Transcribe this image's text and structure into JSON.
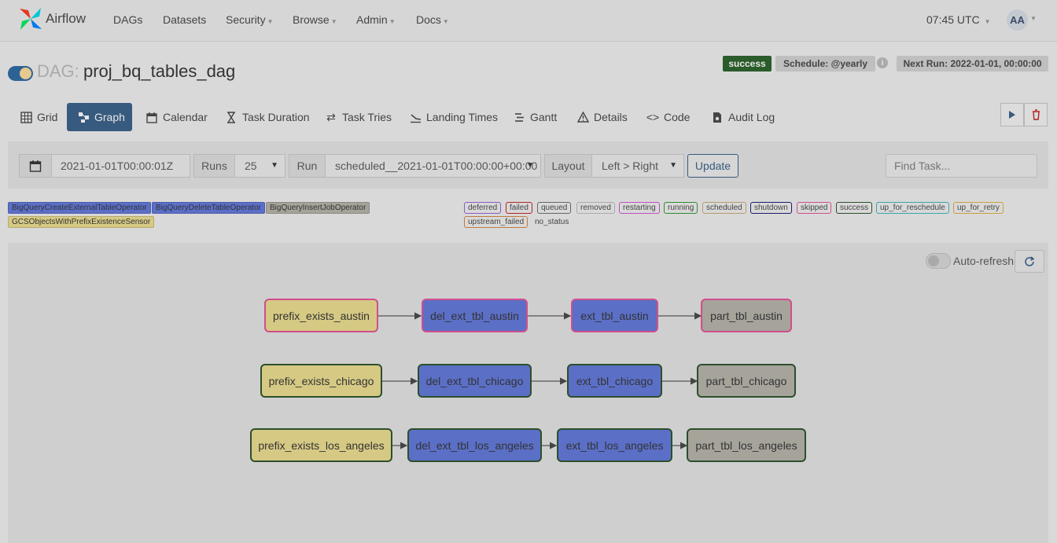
{
  "navbar": {
    "brand": "Airflow",
    "items": [
      {
        "label": "DAGs",
        "dropdown": false
      },
      {
        "label": "Datasets",
        "dropdown": false
      },
      {
        "label": "Security",
        "dropdown": true
      },
      {
        "label": "Browse",
        "dropdown": true
      },
      {
        "label": "Admin",
        "dropdown": true
      },
      {
        "label": "Docs",
        "dropdown": true
      }
    ],
    "clock": "07:45 UTC",
    "avatar": "AA"
  },
  "dag": {
    "prefix": "DAG:",
    "name": "proj_bq_tables_dag",
    "status": "success",
    "schedule": "Schedule: @yearly",
    "next_run": "Next Run: 2022-01-01, 00:00:00",
    "toggle_on": true
  },
  "tabs": [
    {
      "label": "Grid",
      "icon": "grid-icon"
    },
    {
      "label": "Graph",
      "icon": "graph-icon",
      "active": true
    },
    {
      "label": "Calendar",
      "icon": "calendar-icon"
    },
    {
      "label": "Task Duration",
      "icon": "hourglass-icon"
    },
    {
      "label": "Task Tries",
      "icon": "retry-icon"
    },
    {
      "label": "Landing Times",
      "icon": "landing-icon"
    },
    {
      "label": "Gantt",
      "icon": "gantt-icon"
    },
    {
      "label": "Details",
      "icon": "warning-icon"
    },
    {
      "label": "Code",
      "icon": "code-icon"
    },
    {
      "label": "Audit Log",
      "icon": "audit-icon"
    }
  ],
  "form": {
    "base_date": "2021-01-01T00:00:01Z",
    "runs_label": "Runs",
    "runs_value": "25",
    "run_label": "Run",
    "run_value": "scheduled__2021-01-01T00:00:00+00:00",
    "layout_label": "Layout",
    "layout_value": "Left > Right",
    "update_label": "Update",
    "find_task_placeholder": "Find Task..."
  },
  "operator_legend": [
    {
      "label": "BigQueryCreateExternalTableOperator",
      "color": "#5b6fc7"
    },
    {
      "label": "BigQueryDeleteTableOperator",
      "color": "#5b6fc7"
    },
    {
      "label": "BigQueryInsertJobOperator",
      "color": "#a6a39b"
    },
    {
      "label": "GCSObjectsWithPrefixExistenceSensor",
      "color": "#d6c984"
    }
  ],
  "state_legend": [
    {
      "label": "deferred",
      "color": "#8a5ac2"
    },
    {
      "label": "failed",
      "color": "#b22222"
    },
    {
      "label": "queued",
      "color": "#666666"
    },
    {
      "label": "removed",
      "color": "#aaaaaa"
    },
    {
      "label": "restarting",
      "color": "#c04ec0"
    },
    {
      "label": "running",
      "color": "#2e8b2e"
    },
    {
      "label": "scheduled",
      "color": "#b59a6a"
    },
    {
      "label": "shutdown",
      "color": "#1a1a6a"
    },
    {
      "label": "skipped",
      "color": "#d04e8c"
    },
    {
      "label": "success",
      "color": "#2c4f2c"
    },
    {
      "label": "up_for_reschedule",
      "color": "#3aa6a6"
    },
    {
      "label": "up_for_retry",
      "color": "#c9a040"
    },
    {
      "label": "upstream_failed",
      "color": "#c07a40"
    },
    {
      "label": "no_status",
      "color": "none"
    }
  ],
  "graph": {
    "auto_refresh_label": "Auto-refresh",
    "auto_refresh_on": false,
    "rows": [
      [
        "prefix_exists_austin",
        "del_ext_tbl_austin",
        "ext_tbl_austin",
        "part_tbl_austin"
      ],
      [
        "prefix_exists_chicago",
        "del_ext_tbl_chicago",
        "ext_tbl_chicago",
        "part_tbl_chicago"
      ],
      [
        "prefix_exists_los_angeles",
        "del_ext_tbl_los_angeles",
        "ext_tbl_los_angeles",
        "part_tbl_los_angeles"
      ]
    ],
    "row_states": [
      "skipped",
      "success",
      "success"
    ]
  }
}
